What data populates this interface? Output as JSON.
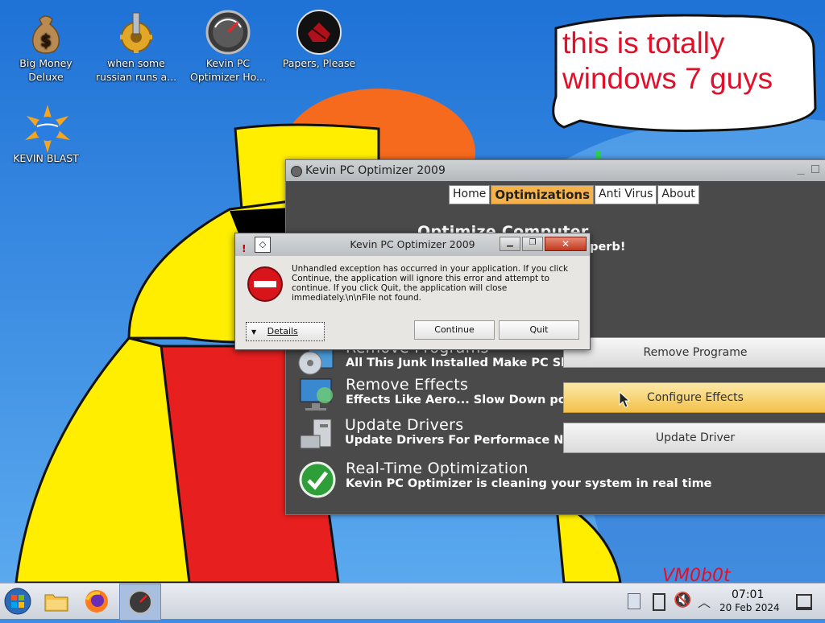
{
  "desktop": {
    "icons": [
      {
        "label": "Big Money Deluxe",
        "icon": "money-bag-icon"
      },
      {
        "label": "when some russian runs a...",
        "icon": "gear-icon"
      },
      {
        "label": "Kevin PC Optimizer Ho...",
        "icon": "gauge-icon"
      },
      {
        "label": "Papers, Please",
        "icon": "papers-please-icon"
      },
      {
        "label": "KEVIN BLAST",
        "icon": "blast-globe-icon"
      }
    ],
    "speech_bubble": "this is totally windows 7 guys",
    "watermark": "VM0b0t"
  },
  "main_window": {
    "title": "Kevin PC Optimizer 2009",
    "tabs": [
      "Home",
      "Optimizations",
      "Anti Virus",
      "About"
    ],
    "active_tab": "Optimizations",
    "sections": [
      {
        "heading": "Optimize Computer",
        "sub": "It Make PC Really Fast! Superb!"
      },
      {
        "heading": "Remove Programs",
        "sub": "All This Junk Installed Make PC Slow",
        "button": "Remove Programe"
      },
      {
        "heading": "Remove Effects",
        "sub": "Effects Like Aero... Slow Down pc.",
        "button": "Configure Effects"
      },
      {
        "heading": "Update Drivers",
        "sub": "Update Drivers For Performace Now",
        "button": "Update Driver"
      },
      {
        "heading": "Real-Time Optimization",
        "sub": "Kevin PC Optimizer is cleaning your system in real time"
      }
    ]
  },
  "dialog": {
    "title": "Kevin PC Optimizer 2009",
    "message": "Unhandled exception has occurred in your application. If you click Continue, the application will ignore this error and attempt to continue. If you click Quit, the application will close immediately.\\n\\nFile not found.",
    "details_label": "Details",
    "continue_label": "Continue",
    "quit_label": "Quit"
  },
  "taskbar": {
    "clock_time": "07:01",
    "clock_date": "20 Feb 2024",
    "apps": [
      "start-orb-icon",
      "file-explorer-icon",
      "firefox-icon",
      "kevin-optimizer-taskbar-icon"
    ]
  },
  "colors": {
    "accent_orange": "#f6b24a",
    "desktop_blue": "#3d8ee6",
    "error_red": "#d9151c"
  }
}
